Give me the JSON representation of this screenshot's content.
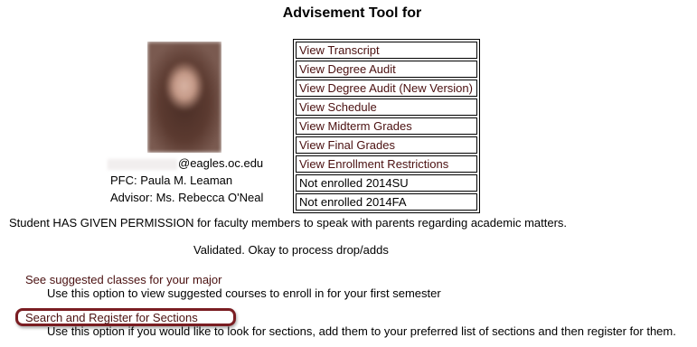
{
  "page": {
    "title": "Advisement Tool for"
  },
  "student": {
    "email_suffix": "@eagles.oc.edu",
    "pfc": "PFC: Paula M. Leaman",
    "advisor": "Advisor: Ms. Rebecca O'Neal"
  },
  "links": [
    {
      "label": "View Transcript",
      "is_link": true
    },
    {
      "label": "View Degree Audit",
      "is_link": true
    },
    {
      "label": "View Degree Audit (New Version)",
      "is_link": true
    },
    {
      "label": "View Schedule",
      "is_link": true
    },
    {
      "label": "View Midterm Grades",
      "is_link": true
    },
    {
      "label": "View Final Grades",
      "is_link": true
    },
    {
      "label": "View Enrollment Restrictions",
      "is_link": true
    },
    {
      "label": "Not enrolled 2014SU",
      "is_link": false
    },
    {
      "label": "Not enrolled 2014FA",
      "is_link": false
    }
  ],
  "notices": {
    "permission": "Student HAS GIVEN PERMISSION for faculty members to speak with parents regarding academic matters.",
    "validated": "Validated. Okay to process drop/adds"
  },
  "options": [
    {
      "label": "See suggested classes for your major",
      "description": "Use this option to view suggested courses to enroll in for your first semester"
    },
    {
      "label": "Search and Register for Sections",
      "description": "Use this option if you would like to look for sections, add them to your preferred list of sections and then register for them."
    }
  ],
  "colors": {
    "link": "#4a1010",
    "highlight": "#7a1d22"
  }
}
